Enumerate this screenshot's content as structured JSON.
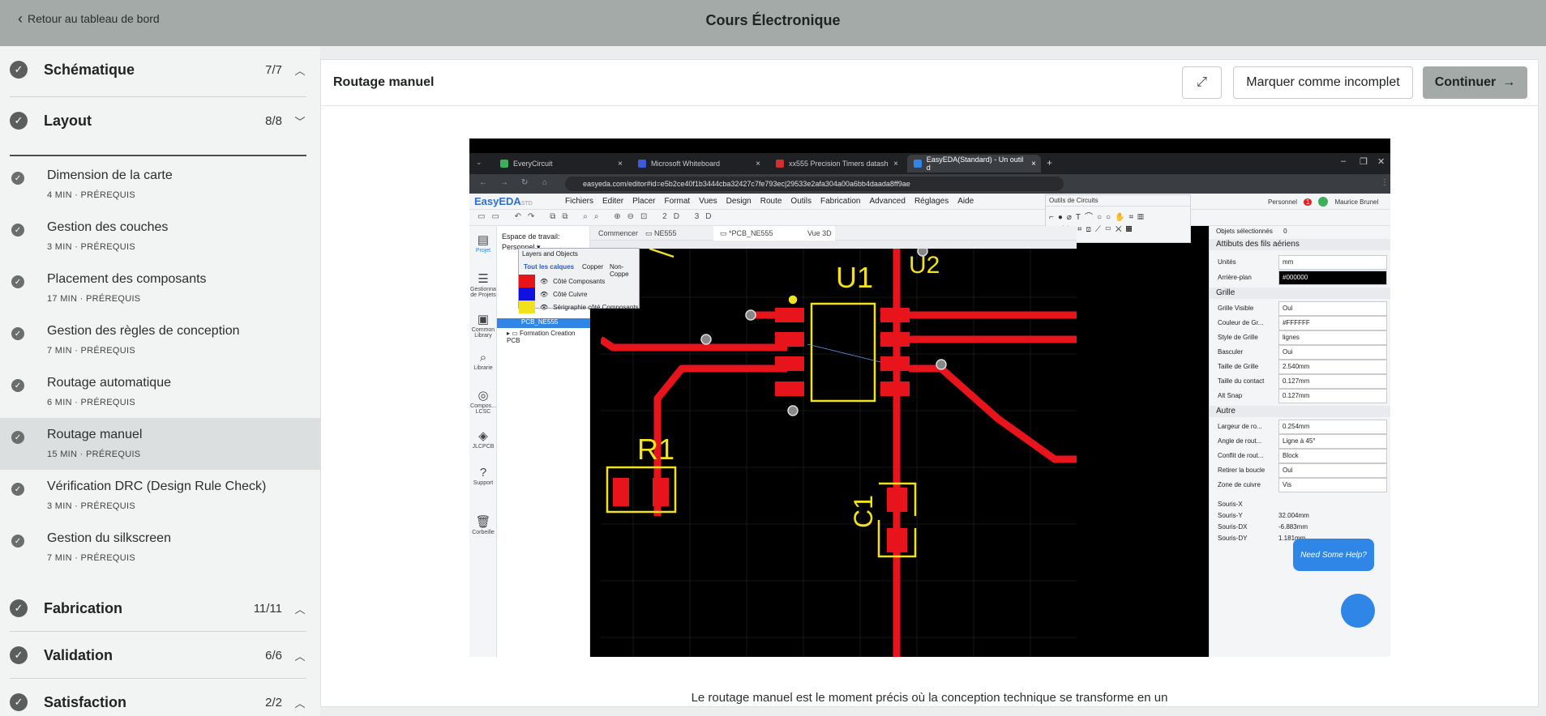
{
  "header": {
    "back_label": "Retour au tableau de bord",
    "course_title": "Cours Électronique"
  },
  "sidebar": {
    "sections_top": [
      {
        "title": "Schématique",
        "count": "7/7"
      },
      {
        "title": "Layout",
        "count": "8/8"
      }
    ],
    "lessons": [
      {
        "title": "Dimension de la carte",
        "duration": "4 MIN",
        "tag": "PRÉREQUIS"
      },
      {
        "title": "Gestion des couches",
        "duration": "3 MIN",
        "tag": "PRÉREQUIS"
      },
      {
        "title": "Placement des composants",
        "duration": "17 MIN",
        "tag": "PRÉREQUIS"
      },
      {
        "title": "Gestion des règles de conception",
        "duration": "7 MIN",
        "tag": "PRÉREQUIS"
      },
      {
        "title": "Routage automatique",
        "duration": "6 MIN",
        "tag": "PRÉREQUIS"
      },
      {
        "title": "Routage manuel",
        "duration": "15 MIN",
        "tag": "PRÉREQUIS"
      },
      {
        "title": "Vérification DRC (Design Rule Check)",
        "duration": "3 MIN",
        "tag": "PRÉREQUIS"
      },
      {
        "title": "Gestion du silkscreen",
        "duration": "7 MIN",
        "tag": "PRÉREQUIS"
      }
    ],
    "sections_bottom": [
      {
        "title": "Fabrication",
        "count": "11/11"
      },
      {
        "title": "Validation",
        "count": "6/6"
      },
      {
        "title": "Satisfaction",
        "count": "2/2"
      }
    ]
  },
  "lesson": {
    "title": "Routage manuel",
    "mark_incomplete": "Marquer comme incomplet",
    "continue": "Continuer",
    "intro": "Le routage manuel est le moment précis où la conception technique se transforme en un"
  },
  "screenshot": {
    "browser_tabs": [
      "EveryCircuit",
      "Microsoft Whiteboard",
      "xx555 Precision Timers datash",
      "EasyEDA(Standard) - Un outil d"
    ],
    "url": "easyeda.com/editor#id=e5b2ce40f1b3444cba32427c7fe793ec|29533e2afa304a00a6bb4daada8ff9ae",
    "menu": [
      "Fichiers",
      "Editer",
      "Placer",
      "Format",
      "Vues",
      "Design",
      "Route",
      "Outils",
      "Fabrication",
      "Advanced",
      "Réglages",
      "Aide"
    ],
    "logo": "EasyEDA",
    "logo_sub": "STD",
    "user_space": "Personnel",
    "user_name": "Maurice Brunel",
    "notif_count": "1",
    "circuit_tools_title": "Outils de Circuits",
    "rail": [
      "Projet",
      "Gestionna de Projets",
      "Common Library",
      "Librarie",
      "Compos... LCSC",
      "JLCPCB",
      "Support",
      "Corbeille"
    ],
    "workspace_label": "Espace de travail:",
    "workspace_value": "Personnel",
    "project_items": [
      "PCB_NE555",
      "Formation Creation PCB"
    ],
    "doc_tabs": [
      "Commencer",
      "NE555",
      "*PCB_NE555",
      "Vue 3D"
    ],
    "layers_title": "Layers and Objects",
    "layer_tabs": [
      "Tout les calques",
      "Copper",
      "Non-Coppe"
    ],
    "layers": [
      {
        "name": "Côté Composants",
        "color": "#e8141b"
      },
      {
        "name": "Côté Cuivre",
        "color": "#1010e0"
      },
      {
        "name": "Sérigraphie côté Composants",
        "color": "#f2e21e"
      }
    ],
    "selected_objects": "Objets sélectionnés",
    "selected_count": "0",
    "sections": {
      "wires": "Attibuts des fils aériens",
      "grid": "Grille",
      "other": "Autre"
    },
    "props": [
      {
        "label": "Unités",
        "value": "mm"
      },
      {
        "label": "Arrière-plan",
        "value": "#000000"
      },
      {
        "label": "Grille Visible",
        "value": "Oui"
      },
      {
        "label": "Couleur de Gr...",
        "value": "#FFFFFF"
      },
      {
        "label": "Style de Grille",
        "value": "lignes"
      },
      {
        "label": "Basculer",
        "value": "Oui"
      },
      {
        "label": "Taille de Grille",
        "value": "2.540mm"
      },
      {
        "label": "Taille du contact",
        "value": "0.127mm"
      },
      {
        "label": "Alt Snap",
        "value": "0.127mm"
      },
      {
        "label": "Largeur de ro...",
        "value": "0.254mm"
      },
      {
        "label": "Angle de rout...",
        "value": "Ligne à 45°"
      },
      {
        "label": "Conflit de rout...",
        "value": "Block"
      },
      {
        "label": "Retirer la boucle",
        "value": "Oui"
      },
      {
        "label": "Zone de cuivre",
        "value": "Vis"
      }
    ],
    "mouse": [
      {
        "label": "Souris-X",
        "value": ""
      },
      {
        "label": "Souris-Y",
        "value": "32.004mm"
      },
      {
        "label": "Souris-DX",
        "value": "-6.883mm"
      },
      {
        "label": "Souris-DY",
        "value": "1.181mm"
      }
    ],
    "help": "Need Some Help?",
    "pcb_labels": {
      "u1": "U1",
      "u2": "U2",
      "r1": "R1",
      "c1": "C1"
    }
  },
  "colors": {
    "topbar": "#a3aaa8",
    "copper_top": "#e8141b",
    "silkscreen": "#f2e21e",
    "accent_blue": "#2f86e6"
  }
}
